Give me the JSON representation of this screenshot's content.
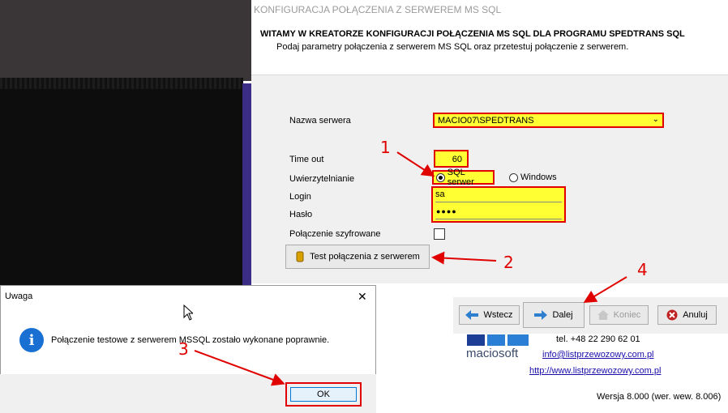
{
  "wizard": {
    "window_title": "KONFIGURACJA POŁĄCZENIA Z SERWEREM MS SQL",
    "heading": "WITAMY W KREATORZE KONFIGURACJI POŁĄCZENIA MS SQL DLA PROGRAMU SPEDTRANS SQL",
    "subheading": "Podaj parametry połączenia z serwerem MS SQL oraz przetestuj połączenie z serwerem.",
    "server_label": "Nazwa serwera",
    "server_value": "MACIO07\\SPEDTRANS",
    "timeout_label": "Time out",
    "timeout_value": "60",
    "auth_label": "Uwierzytelnianie",
    "auth_sql": "SQL serwer",
    "auth_windows": "Windows",
    "login_label": "Login",
    "login_value": "sa",
    "password_label": "Hasło",
    "password_value": "●●●●",
    "encrypted_label": "Połączenie szyfrowane",
    "test_button": "Test połączenia z serwerem",
    "back_button": "Wstecz",
    "next_button": "Dalej",
    "finish_button": "Koniec",
    "cancel_button": "Anuluj"
  },
  "footer": {
    "logo_text": "maciosoft",
    "phone": "tel. +48 22 290 62 01",
    "email": "info@listprzewozowy.com.pl",
    "url": "http://www.listprzewozowy.com.pl",
    "version": "Wersja 8.000 (wer. wew. 8.006)"
  },
  "dialog": {
    "title": "Uwaga",
    "close_glyph": "✕",
    "message": "Połączenie testowe z serwerem MSSQL zostało wykonane poprawnie.",
    "ok_button": "OK"
  },
  "annotations": {
    "n1": "1",
    "n2": "2",
    "n3": "3",
    "n4": "4"
  },
  "colors": {
    "highlight": "#ffff33",
    "annotation_red": "#e00000",
    "info_blue": "#1a6fd2"
  }
}
